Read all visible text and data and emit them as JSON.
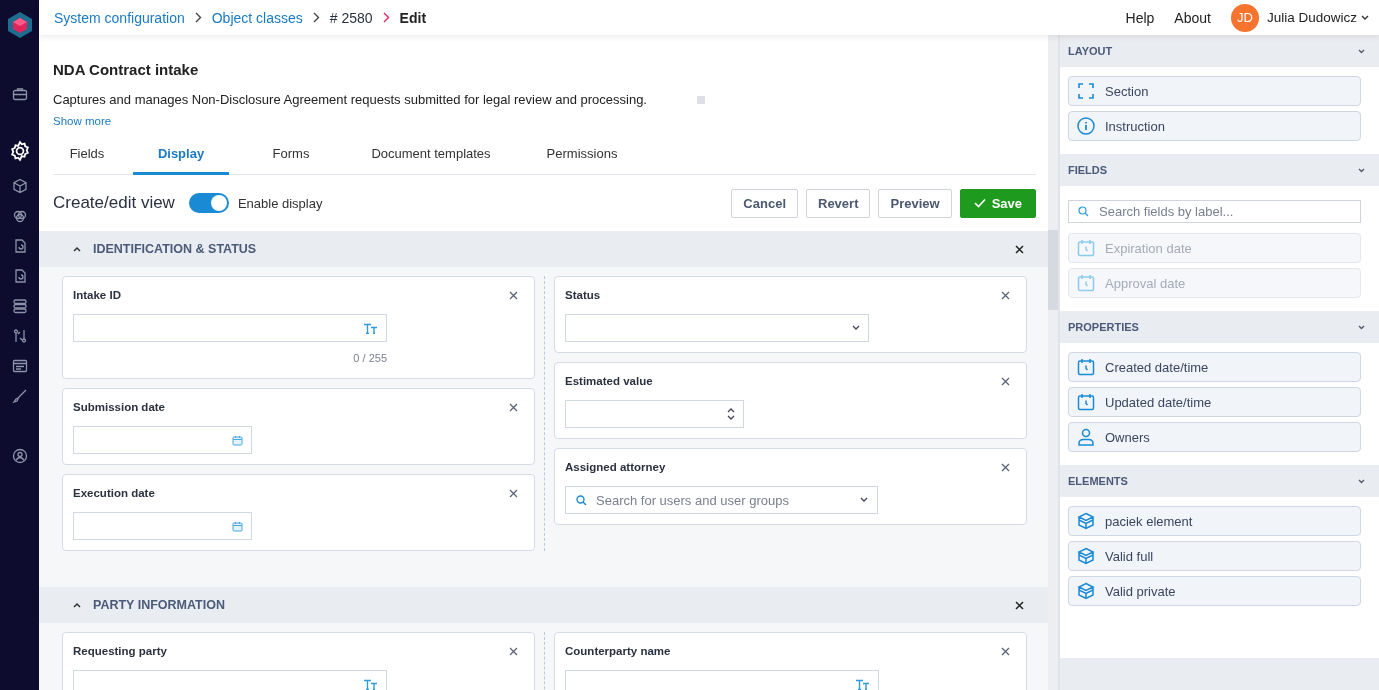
{
  "breadcrumb": [
    {
      "label": "System configuration",
      "kind": "link"
    },
    {
      "label": "Object classes",
      "kind": "link"
    },
    {
      "label": "# 2580",
      "kind": "text"
    },
    {
      "label": "Edit",
      "kind": "current"
    }
  ],
  "topbar": {
    "links": [
      "Help",
      "About"
    ],
    "user": {
      "initials": "JD",
      "name": "Julia Dudowicz"
    }
  },
  "sidebar": {
    "items": [
      {
        "selected": false
      },
      {
        "selected": true
      },
      {
        "selected": false
      },
      {
        "selected": false
      },
      {
        "selected": false
      },
      {
        "selected": false
      },
      {
        "selected": false
      },
      {
        "selected": false
      },
      {
        "selected": false
      },
      {
        "selected": false
      },
      {
        "selected": false
      }
    ]
  },
  "object": {
    "title": "NDA Contract intake",
    "description": "Captures and manages Non-Disclosure Agreement requests submitted for legal review and processing.",
    "show_more": "Show more"
  },
  "tabs": [
    {
      "label": "Fields",
      "selected": false
    },
    {
      "label": "Display",
      "selected": true
    },
    {
      "label": "Forms",
      "selected": false
    },
    {
      "label": "Document templates",
      "selected": false
    },
    {
      "label": "Permissions",
      "selected": false
    }
  ],
  "view": {
    "title": "Create/edit view",
    "toggle_label": "Enable display",
    "enabled": true
  },
  "actions": [
    {
      "label": "Cancel",
      "kind": "default"
    },
    {
      "label": "Revert",
      "kind": "default"
    },
    {
      "label": "Preview",
      "kind": "default"
    },
    {
      "label": "Save",
      "kind": "primary"
    }
  ],
  "sections": [
    {
      "title": "IDENTIFICATION & STATUS",
      "expanded": true,
      "columns": [
        [
          {
            "label": "Intake ID",
            "kind": "text",
            "counter": "0 / 255"
          },
          {
            "label": "Submission date",
            "kind": "date"
          },
          {
            "label": "Execution date",
            "kind": "date"
          }
        ],
        [
          {
            "label": "Status",
            "kind": "select"
          },
          {
            "label": "Estimated value",
            "kind": "number"
          },
          {
            "label": "Assigned attorney",
            "kind": "user",
            "placeholder": "Search for users and user groups"
          }
        ]
      ]
    },
    {
      "title": "PARTY INFORMATION",
      "expanded": true,
      "columns": [
        [
          {
            "label": "Requesting party",
            "kind": "text"
          }
        ],
        [
          {
            "label": "Counterparty name",
            "kind": "text"
          }
        ]
      ]
    }
  ],
  "palette": [
    {
      "title": "LAYOUT",
      "expanded": true,
      "items": [
        {
          "label": "Section",
          "kind": "section",
          "disabled": false
        },
        {
          "label": "Instruction",
          "kind": "info",
          "disabled": false
        }
      ]
    },
    {
      "title": "FIELDS",
      "expanded": true,
      "search_placeholder": "Search fields by label...",
      "items": [
        {
          "label": "Expiration date",
          "kind": "date",
          "disabled": true
        },
        {
          "label": "Approval date",
          "kind": "date",
          "disabled": true
        }
      ]
    },
    {
      "title": "PROPERTIES",
      "expanded": true,
      "items": [
        {
          "label": "Created date/time",
          "kind": "date",
          "disabled": false
        },
        {
          "label": "Updated date/time",
          "kind": "date",
          "disabled": false
        },
        {
          "label": "Owners",
          "kind": "user",
          "disabled": false
        }
      ]
    },
    {
      "title": "ELEMENTS",
      "expanded": true,
      "items": [
        {
          "label": "paciek element",
          "kind": "box",
          "disabled": false
        },
        {
          "label": "Valid full",
          "kind": "box",
          "disabled": false
        },
        {
          "label": "Valid private",
          "kind": "box",
          "disabled": false
        }
      ]
    }
  ]
}
